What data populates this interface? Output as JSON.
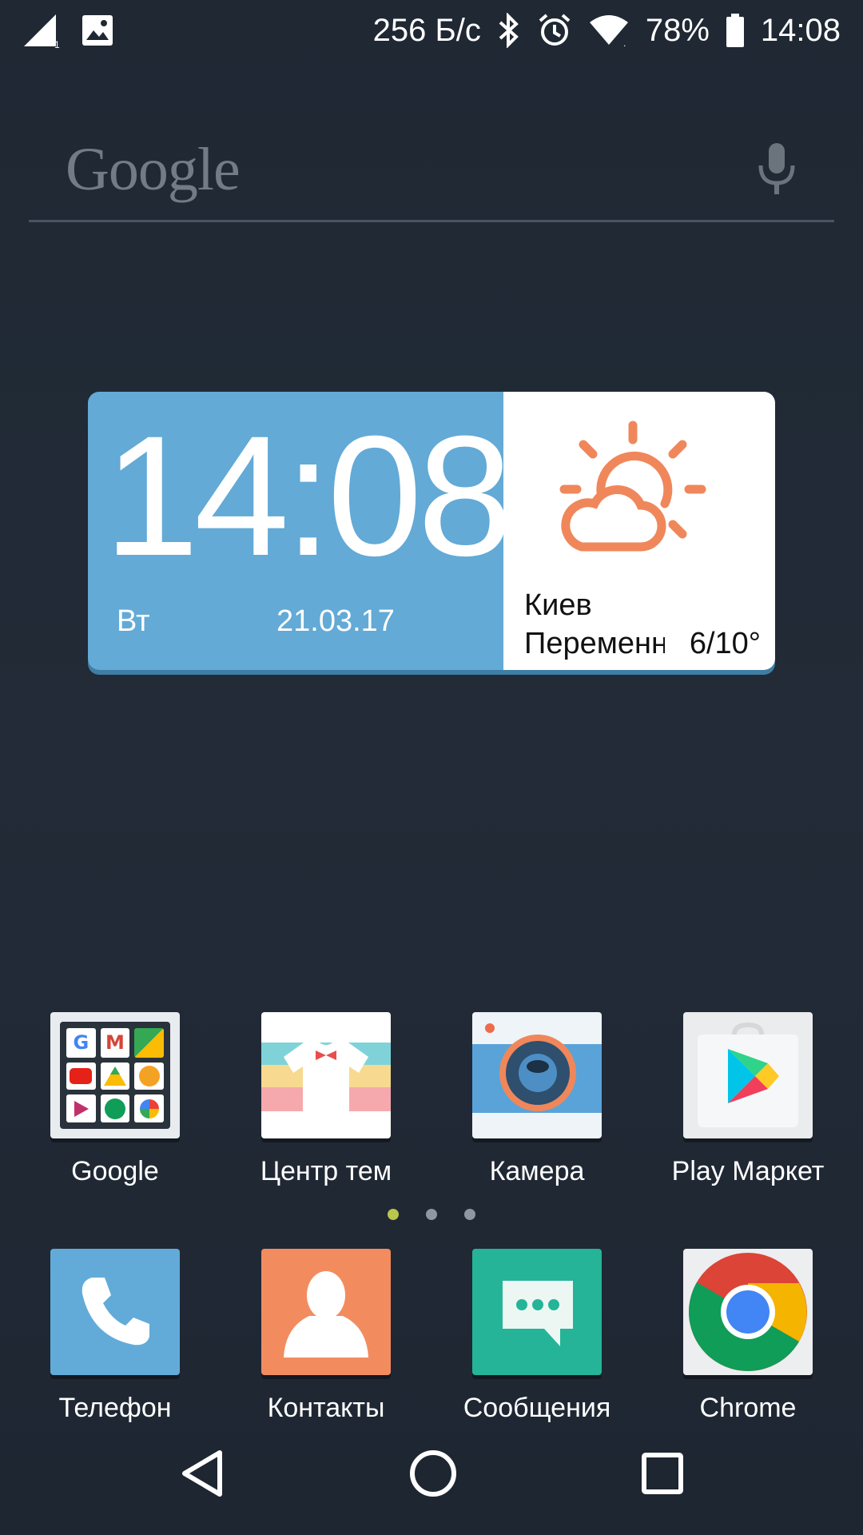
{
  "status_bar": {
    "network_speed": "256 Б/с",
    "battery": "78%",
    "time": "14:08",
    "icons": [
      "signal-icon",
      "image-icon",
      "bluetooth-icon",
      "alarm-icon",
      "wifi-icon",
      "battery-icon"
    ]
  },
  "search": {
    "logo": "Google",
    "mic_icon": "mic-icon"
  },
  "widget": {
    "time": "14:08",
    "day": "Вт",
    "date": "21.03.17",
    "city": "Киев",
    "condition": "Переменная облачность",
    "temperature": "6/10°",
    "weather_icon": "partly-cloudy-icon",
    "colors": {
      "clock_bg": "#63aad6",
      "weather_icon": "#f0875a"
    }
  },
  "apps": [
    {
      "label": "Google",
      "icon": "google-folder-icon"
    },
    {
      "label": "Центр тем",
      "icon": "themes-icon"
    },
    {
      "label": "Камера",
      "icon": "camera-icon"
    },
    {
      "label": "Play Маркет",
      "icon": "play-store-icon"
    }
  ],
  "dock": [
    {
      "label": "Телефон",
      "icon": "phone-icon",
      "color": "#62abd9"
    },
    {
      "label": "Контакты",
      "icon": "contacts-icon",
      "color": "#f28c5f"
    },
    {
      "label": "Сообщения",
      "icon": "messages-icon",
      "color": "#25b497"
    },
    {
      "label": "Chrome",
      "icon": "chrome-icon"
    }
  ],
  "page_indicator": {
    "pages": 3,
    "current": 1
  },
  "nav": {
    "icons": [
      "back-icon",
      "home-icon",
      "recents-icon"
    ]
  }
}
